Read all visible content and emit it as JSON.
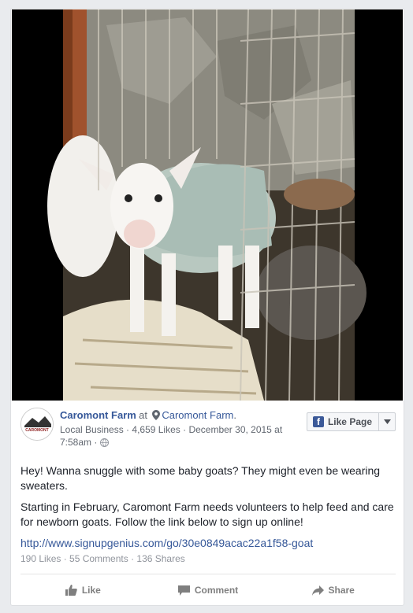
{
  "post": {
    "page_name": "Caromont Farm",
    "at_text": "at",
    "location": "Caromont Farm",
    "location_suffix": ".",
    "category": "Local Business",
    "likes_count": "4,659 Likes",
    "date": "December 30, 2015 at 7:58am",
    "avatar_text": "CAROMONT",
    "like_page_label": "Like Page",
    "paragraph1": "Hey! Wanna snuggle with some baby goats? They might even be wearing sweaters.",
    "paragraph2": "Starting in February, Caromont Farm needs volunteers to help feed and care for newborn goats. Follow the link below to sign up online!",
    "link": "http://www.signupgenius.com/go/30e0849acac22a1f58-goat",
    "stats": "190 Likes · 55 Comments · 136 Shares"
  },
  "actions": {
    "like": "Like",
    "comment": "Comment",
    "share": "Share"
  },
  "icons": {
    "pin": "map-pin-icon",
    "globe": "globe-icon",
    "facebook": "facebook-logo-icon",
    "caret": "chevron-down-icon",
    "like": "thumbs-up-icon",
    "comment": "comment-bubble-icon",
    "share": "share-arrow-icon"
  },
  "colors": {
    "link": "#365899",
    "facebook_blue": "#3b5998",
    "meta_gray": "#616770",
    "action_gray": "#7f7f7f"
  }
}
